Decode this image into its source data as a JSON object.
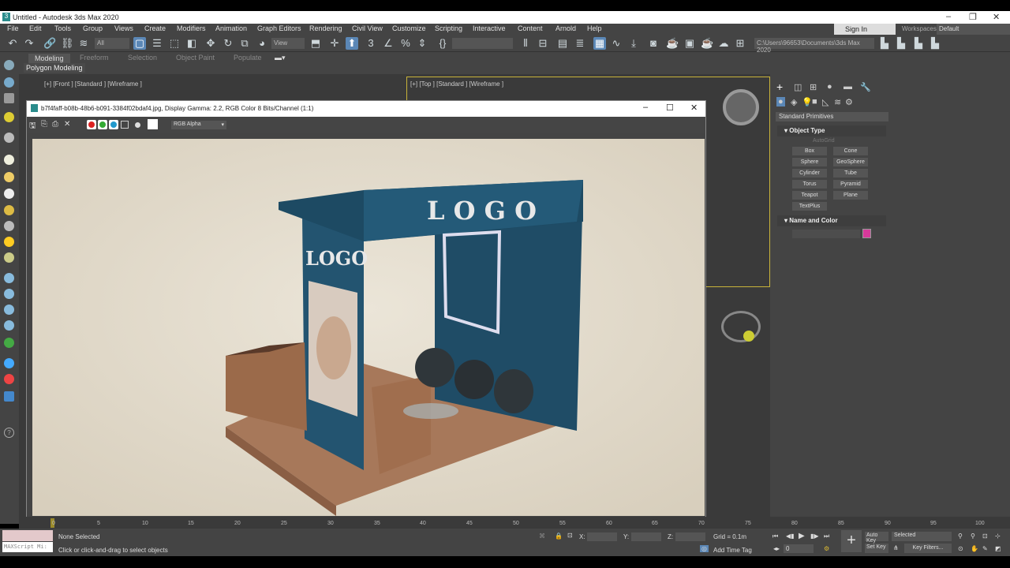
{
  "window": {
    "title": "Untitled - Autodesk 3ds Max 2020",
    "app_icon": "3"
  },
  "menu": [
    "File",
    "Edit",
    "Tools",
    "Group",
    "Views",
    "Create",
    "Modifiers",
    "Animation",
    "Graph Editors",
    "Rendering",
    "Civil View",
    "Customize",
    "Scripting",
    "Interactive",
    "Content",
    "Arnold",
    "Help"
  ],
  "toolbar": {
    "selection_filter": "All",
    "ref_coord": "View",
    "sign_in": "Sign In",
    "workspaces_label": "Workspaces:",
    "workspace": "Default",
    "project_path": "C:\\Users\\96653\\Documents\\3ds Max 2020"
  },
  "ribbon": {
    "tabs": [
      "Modeling",
      "Freeform",
      "Selection",
      "Object Paint",
      "Populate"
    ],
    "sub": "Polygon Modeling"
  },
  "viewports": {
    "front": "[+] [Front ] [Standard ] [Wireframe ]",
    "top": "[+] [Top ] [Standard ] [Wireframe ]"
  },
  "frame_window": {
    "title": "b7f4faff-b08b-48b6-b091-3384f02bdaf4.jpg, Display Gamma: 2.2, RGB Color 8 Bits/Channel (1:1)",
    "channel": "RGB Alpha",
    "render_text": {
      "logo_top": "L O G O",
      "logo_side": "LOGO"
    }
  },
  "command_panel": {
    "category": "Standard Primitives",
    "object_type": "Object Type",
    "autogrid": "AutoGrid",
    "buttons": [
      "Box",
      "Cone",
      "Sphere",
      "GeoSphere",
      "Cylinder",
      "Tube",
      "Torus",
      "Pyramid",
      "Teapot",
      "Plane",
      "TextPlus"
    ],
    "name_and_color": "Name and Color",
    "color": "#d6399a"
  },
  "timeline": {
    "ticks": [
      "0",
      "5",
      "10",
      "15",
      "20",
      "25",
      "30",
      "35",
      "40",
      "45",
      "50",
      "55",
      "60",
      "65",
      "70",
      "75",
      "80",
      "85",
      "90",
      "95",
      "100"
    ]
  },
  "status": {
    "maxscript": "MAXScript Mi:",
    "selection": "None Selected",
    "prompt": "Click or click-and-drag to select objects",
    "x": "X:",
    "y": "Y:",
    "z": "Z:",
    "grid": "Grid = 0.1m",
    "add_time_tag": "Add Time Tag",
    "frame": "0",
    "auto_key": "Auto Key",
    "set_key": "Set Key",
    "key_mode": "Selected",
    "key_filters": "Key Filters..."
  }
}
